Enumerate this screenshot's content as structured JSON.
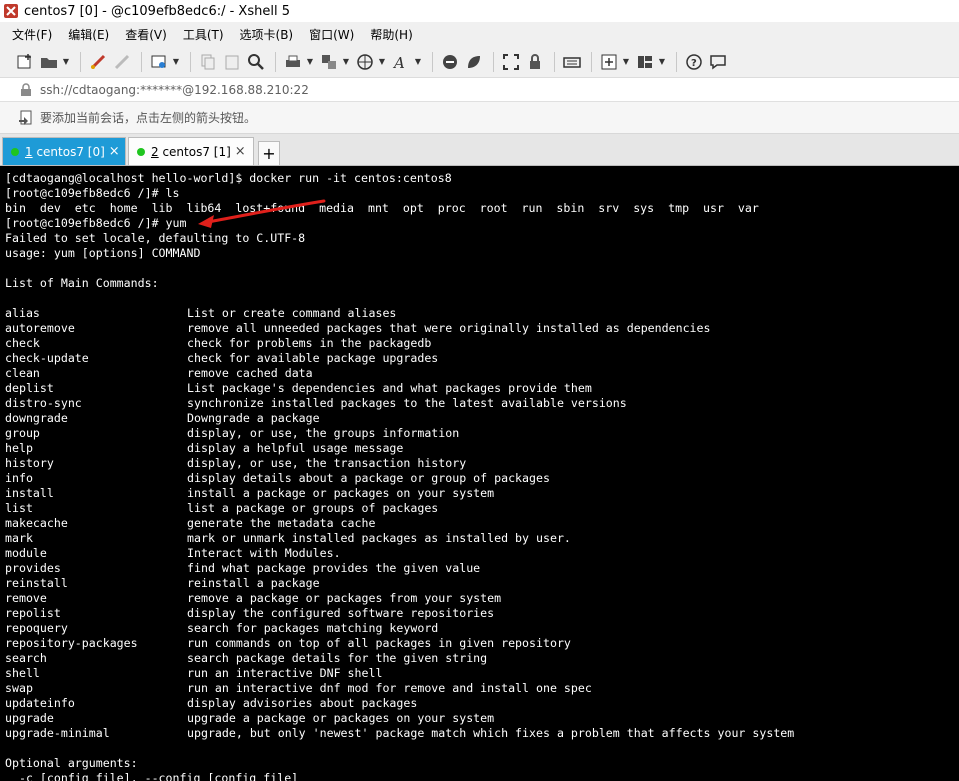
{
  "window": {
    "title": "centos7 [0] - @c109efb8edc6:/ - Xshell 5"
  },
  "menu": [
    {
      "label": "文件(F)"
    },
    {
      "label": "编辑(E)"
    },
    {
      "label": "查看(V)"
    },
    {
      "label": "工具(T)"
    },
    {
      "label": "选项卡(B)"
    },
    {
      "label": "窗口(W)"
    },
    {
      "label": "帮助(H)"
    }
  ],
  "address": {
    "text": "ssh://cdtaogang:*******@192.168.88.210:22"
  },
  "hint": {
    "text": "要添加当前会话，点击左侧的箭头按钮。"
  },
  "tabs": [
    {
      "num": "1",
      "label": " centos7 [0]",
      "close": "×"
    },
    {
      "num": "2",
      "label": " centos7 [1]",
      "close": "×"
    }
  ],
  "tab_add": "+",
  "terminal": {
    "pre_lines": [
      "[cdtaogang@localhost hello-world]$ docker run -it centos:centos8",
      "[root@c109efb8edc6 /]# ls",
      "bin  dev  etc  home  lib  lib64  lost+found  media  mnt  opt  proc  root  run  sbin  srv  sys  tmp  usr  var",
      "[root@c109efb8edc6 /]# yum",
      "Failed to set locale, defaulting to C.UTF-8",
      "usage: yum [options] COMMAND",
      "",
      "List of Main Commands:",
      ""
    ],
    "commands": [
      {
        "name": "alias",
        "desc": "List or create command aliases"
      },
      {
        "name": "autoremove",
        "desc": "remove all unneeded packages that were originally installed as dependencies"
      },
      {
        "name": "check",
        "desc": "check for problems in the packagedb"
      },
      {
        "name": "check-update",
        "desc": "check for available package upgrades"
      },
      {
        "name": "clean",
        "desc": "remove cached data"
      },
      {
        "name": "deplist",
        "desc": "List package's dependencies and what packages provide them"
      },
      {
        "name": "distro-sync",
        "desc": "synchronize installed packages to the latest available versions"
      },
      {
        "name": "downgrade",
        "desc": "Downgrade a package"
      },
      {
        "name": "group",
        "desc": "display, or use, the groups information"
      },
      {
        "name": "help",
        "desc": "display a helpful usage message"
      },
      {
        "name": "history",
        "desc": "display, or use, the transaction history"
      },
      {
        "name": "info",
        "desc": "display details about a package or group of packages"
      },
      {
        "name": "install",
        "desc": "install a package or packages on your system"
      },
      {
        "name": "list",
        "desc": "list a package or groups of packages"
      },
      {
        "name": "makecache",
        "desc": "generate the metadata cache"
      },
      {
        "name": "mark",
        "desc": "mark or unmark installed packages as installed by user."
      },
      {
        "name": "module",
        "desc": "Interact with Modules."
      },
      {
        "name": "provides",
        "desc": "find what package provides the given value"
      },
      {
        "name": "reinstall",
        "desc": "reinstall a package"
      },
      {
        "name": "remove",
        "desc": "remove a package or packages from your system"
      },
      {
        "name": "repolist",
        "desc": "display the configured software repositories"
      },
      {
        "name": "repoquery",
        "desc": "search for packages matching keyword"
      },
      {
        "name": "repository-packages",
        "desc": "run commands on top of all packages in given repository"
      },
      {
        "name": "search",
        "desc": "search package details for the given string"
      },
      {
        "name": "shell",
        "desc": "run an interactive DNF shell"
      },
      {
        "name": "swap",
        "desc": "run an interactive dnf mod for remove and install one spec"
      },
      {
        "name": "updateinfo",
        "desc": "display advisories about packages"
      },
      {
        "name": "upgrade",
        "desc": "upgrade a package or packages on your system"
      },
      {
        "name": "upgrade-minimal",
        "desc": "upgrade, but only 'newest' package match which fixes a problem that affects your system"
      }
    ],
    "post_lines": [
      "",
      "Optional arguments:",
      "  -c [config file], --config [config file]"
    ]
  },
  "colors": {
    "terminal_bg": "#000000",
    "terminal_fg": "#ffffff",
    "active_tab": "#1e9bd7",
    "session_dot": "#1fc51f",
    "annotation_arrow": "#e0201b"
  }
}
